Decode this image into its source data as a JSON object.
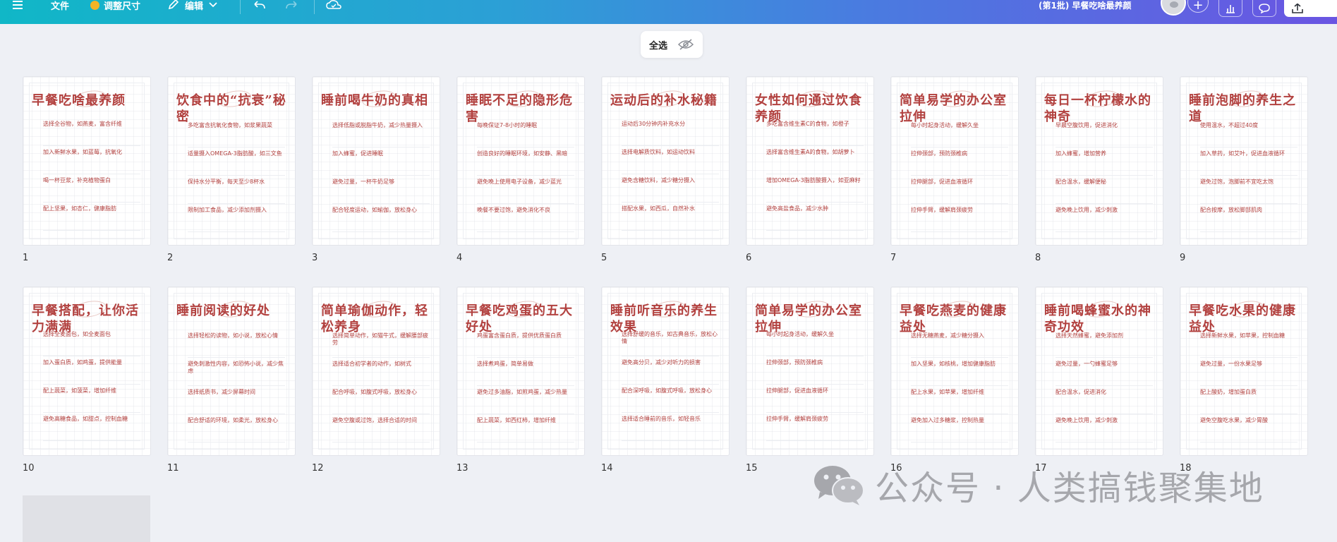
{
  "toolbar": {
    "file_label": "文件",
    "resize_label": "调整尺寸",
    "edit_label": "编辑",
    "doc_title": "(第1批) 早餐吃啥最养颜",
    "share_label": ""
  },
  "select_bar": {
    "select_all_label": "全选"
  },
  "pages": [
    {
      "num": "1",
      "title": "早餐吃啥最养颜",
      "bullets": [
        "选择全谷物，如燕麦，富含纤维",
        "加入新鲜水果，如蓝莓，抗氧化",
        "喝一杯豆浆，补充植物蛋白",
        "配上坚果，如杏仁，健康脂肪"
      ]
    },
    {
      "num": "2",
      "title": "饮食中的“抗衰”秘密",
      "bullets": [
        "多吃富含抗氧化食物，如浆果蔬菜",
        "适量摄入OMEGA-3脂肪酸，如三文鱼",
        "保持水分平衡，每天至少8杯水",
        "限制加工食品，减少添加剂摄入"
      ]
    },
    {
      "num": "3",
      "title": "睡前喝牛奶的真相",
      "bullets": [
        "选择低脂或脱脂牛奶，减少热量摄入",
        "加入蜂蜜，促进睡眠",
        "避免过量，一杯牛奶足够",
        "配合轻度运动，如瑜伽，放松身心"
      ]
    },
    {
      "num": "4",
      "title": "睡眠不足的隐形危害",
      "bullets": [
        "每晚保证7-8小时的睡眠",
        "创造良好的睡眠环境，如安静、黑暗",
        "避免晚上使用电子设备，减少蓝光",
        "晚餐不要过饱，避免消化不良"
      ]
    },
    {
      "num": "5",
      "title": "运动后的补水秘籍",
      "bullets": [
        "运动后30分钟内补充水分",
        "选择电解质饮料，如运动饮料",
        "避免含糖饮料，减少糖分摄入",
        "搭配水果，如西瓜，自然补水"
      ]
    },
    {
      "num": "6",
      "title": "女性如何通过饮食养颜",
      "bullets": [
        "多吃富含维生素C的食物，如橙子",
        "选择富含维生素A的食物，如胡萝卜",
        "增加OMEGA-3脂肪酸摄入，如亚麻籽",
        "避免高盐食品，减少水肿"
      ]
    },
    {
      "num": "7",
      "title": "简单易学的办公室拉伸",
      "bullets": [
        "每小时起身活动，缓解久坐",
        "拉伸颈部，预防颈椎病",
        "拉伸腿部，促进血液循环",
        "拉伸手臂，缓解肩颈疲劳"
      ]
    },
    {
      "num": "8",
      "title": "每日一杯柠檬水的神奇",
      "bullets": [
        "早晨空腹饮用，促进消化",
        "加入蜂蜜，增加营养",
        "配合温水，缓解便秘",
        "避免晚上饮用，减少刺激"
      ]
    },
    {
      "num": "9",
      "title": "睡前泡脚的养生之道",
      "bullets": [
        "使用温水，不超过40度",
        "加入草药，如艾叶，促进血液循环",
        "避免过饱，泡脚前不宜吃太饱",
        "配合按摩，放松脚部肌肉"
      ]
    },
    {
      "num": "10",
      "title": "早餐搭配，让你活力满满",
      "bullets": [
        "选择全麦面包，如全麦面包",
        "加入蛋白质，如鸡蛋，提供能量",
        "配上蔬菜，如菠菜，增加纤维",
        "避免高糖食品，如甜点，控制血糖"
      ]
    },
    {
      "num": "11",
      "title": "睡前阅读的好处",
      "bullets": [
        "选择轻松的读物，如小说，放松心情",
        "避免刺激性内容，如恐怖小说，减少焦虑",
        "选择纸质书，减少屏幕时间",
        "配合舒适的环境，如柔光，放松身心"
      ]
    },
    {
      "num": "12",
      "title": "简单瑜伽动作，轻松养身",
      "bullets": [
        "选择简单动作，如猫牛式，缓解腰部疲劳",
        "选择适合初学者的动作，如树式",
        "配合呼吸，如腹式呼吸，放松身心",
        "避免空腹或过饱，选择合适的时间"
      ]
    },
    {
      "num": "13",
      "title": "早餐吃鸡蛋的五大好处",
      "bullets": [
        "鸡蛋富含蛋白质，提供优质蛋白质",
        "选择煮鸡蛋，简单易做",
        "避免过多油脂，如煎鸡蛋，减少热量",
        "配上蔬菜，如西红柿，增加纤维"
      ]
    },
    {
      "num": "14",
      "title": "睡前听音乐的养生效果",
      "bullets": [
        "选择舒缓的音乐，如古典音乐，放松心情",
        "避免高分贝，减少对听力的损害",
        "配合深呼吸，如腹式呼吸，放松身心",
        "选择适合睡前的音乐，如轻音乐"
      ]
    },
    {
      "num": "15",
      "title": "简单易学的办公室拉伸",
      "bullets": [
        "每小时起身活动，缓解久坐",
        "拉伸颈部，预防颈椎病",
        "拉伸腿部，促进血液循环",
        "拉伸手臂，缓解肩颈疲劳"
      ]
    },
    {
      "num": "16",
      "title": "早餐吃燕麦的健康益处",
      "bullets": [
        "选择无糖燕麦，减少糖分摄入",
        "加入坚果，如核桃，增加健康脂肪",
        "配上水果，如苹果，增加纤维",
        "避免加入过多糖浆，控制热量"
      ]
    },
    {
      "num": "17",
      "title": "睡前喝蜂蜜水的神奇功效",
      "bullets": [
        "选择天然蜂蜜，避免添加剂",
        "避免过量，一勺蜂蜜足够",
        "配合温水，促进消化",
        "避免晚上饮用，减少刺激"
      ]
    },
    {
      "num": "18",
      "title": "早餐吃水果的健康益处",
      "bullets": [
        "选择新鲜水果，如苹果，控制血糖",
        "避免过量，一份水果足够",
        "配上酸奶，增加蛋白质",
        "避免空腹吃水果，减少胃酸"
      ]
    }
  ],
  "watermark": {
    "text": "公众号 · 人类搞钱聚集地"
  },
  "colors": {
    "accent_title": "#b2413f",
    "topbar_start": "#10b7c7",
    "topbar_end": "#6a55e2"
  }
}
